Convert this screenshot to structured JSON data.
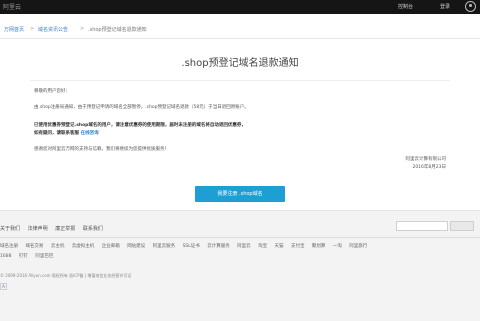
{
  "topbar": {
    "logo": "阿里云",
    "links": [
      "控制台",
      "登录"
    ]
  },
  "breadcrumb": {
    "items": [
      "万网首页",
      "域名资讯公告",
      ".shop预登记域名退款通知"
    ]
  },
  "notice": {
    "title": ".shop预登记域名退款通知",
    "greeting": "尊敬的用户您好：",
    "paragraph1": "由.shop注册局通知，由于预登记申请的域名全部暂停，.shop预登记域名退款（58元）于当日退回原账户。",
    "paragraph2_line1": "已使用优惠券预登记.shop域名的用户，请注意优惠券的使用期限，届时未注册的域名将自动退回优惠券，",
    "paragraph2_line2": "如有疑问，请联系客服",
    "paragraph2_link": "在线咨询",
    "closing": "感谢您对阿里云万网的支持与信赖，我们将继续为您提供优质服务！",
    "sign_company": "阿里云计算有限公司",
    "sign_date": "2016年8月23日"
  },
  "action": {
    "button_label": "我要注册 .shop域名"
  },
  "footer": {
    "links": [
      "关于我们",
      "法律声明",
      "廉正举报",
      "联系我们"
    ],
    "row1": [
      "域名注册",
      "域名交易",
      "云主机",
      "云虚拟主机",
      "企业邮箱",
      "网站建设",
      "阿里云服务",
      "SSL证书",
      "云计算服务",
      "阿里云",
      "淘宝",
      "天猫",
      "支付宝",
      "聚划算",
      "一淘",
      "阿里旅行"
    ],
    "row2": [
      "1688",
      "钉钉",
      "阿里巴巴"
    ],
    "copyright": "© 2009-2016 Aliyun.com 版权所有 浙ICP备 | 增值电信业务经营许可证",
    "badge": "A"
  }
}
